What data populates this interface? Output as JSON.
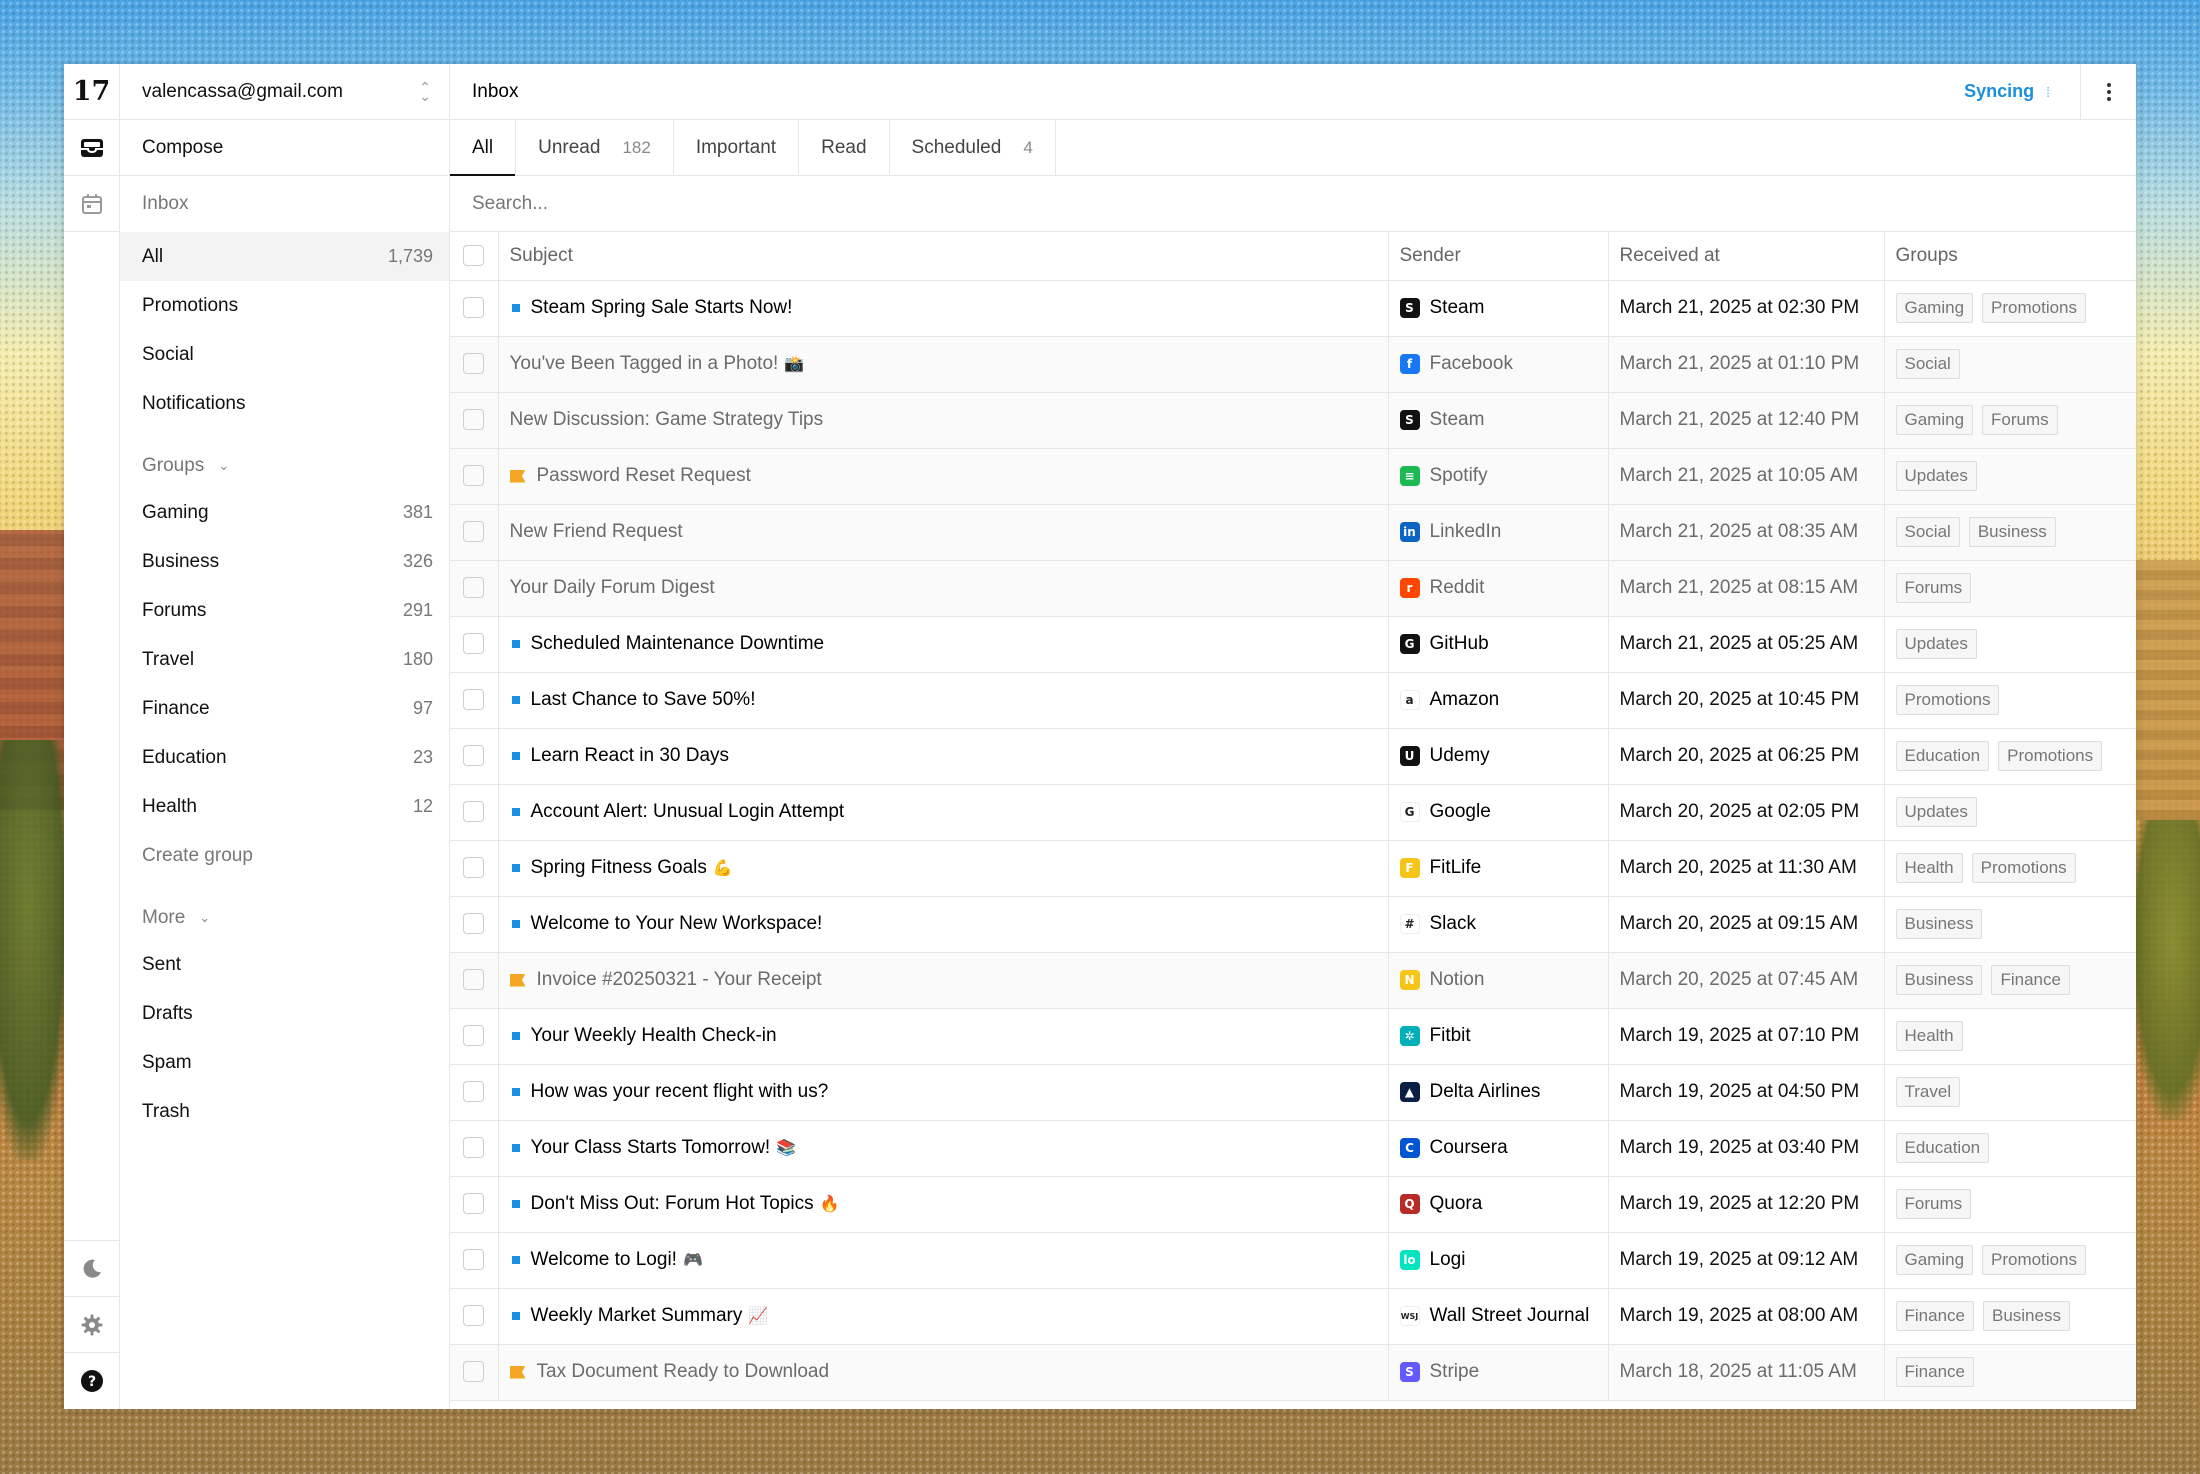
{
  "app": {
    "logo": "17",
    "account": "valencassa@gmail.com",
    "compose": "Compose",
    "inbox_label": "Inbox",
    "create_group": "Create group"
  },
  "sidebar": {
    "main_items": [
      {
        "label": "All",
        "count": "1,739"
      },
      {
        "label": "Promotions",
        "count": ""
      },
      {
        "label": "Social",
        "count": ""
      },
      {
        "label": "Notifications",
        "count": ""
      }
    ],
    "groups_label": "Groups",
    "groups": [
      {
        "label": "Gaming",
        "count": "381"
      },
      {
        "label": "Business",
        "count": "326"
      },
      {
        "label": "Forums",
        "count": "291"
      },
      {
        "label": "Travel",
        "count": "180"
      },
      {
        "label": "Finance",
        "count": "97"
      },
      {
        "label": "Education",
        "count": "23"
      },
      {
        "label": "Health",
        "count": "12"
      }
    ],
    "more_label": "More",
    "more": [
      {
        "label": "Sent"
      },
      {
        "label": "Drafts"
      },
      {
        "label": "Spam"
      },
      {
        "label": "Trash"
      }
    ]
  },
  "header": {
    "title": "Inbox",
    "status": "Syncing"
  },
  "tabs": [
    {
      "label": "All",
      "count": ""
    },
    {
      "label": "Unread",
      "count": "182"
    },
    {
      "label": "Important",
      "count": ""
    },
    {
      "label": "Read",
      "count": ""
    },
    {
      "label": "Scheduled",
      "count": "4"
    }
  ],
  "search": {
    "placeholder": "Search..."
  },
  "table": {
    "columns": [
      "Subject",
      "Sender",
      "Received at",
      "Groups"
    ],
    "rows": [
      {
        "subject": "Steam Spring Sale Starts Now!",
        "emoji": "",
        "marker": "dot",
        "read": false,
        "sender": "Steam",
        "icon": {
          "glyph": "S",
          "bg": "#111111"
        },
        "received": "March 21, 2025 at 02:30 PM",
        "groups": [
          "Gaming",
          "Promotions"
        ]
      },
      {
        "subject": "You've Been Tagged in a Photo!",
        "emoji": "📸",
        "marker": "none",
        "read": true,
        "sender": "Facebook",
        "icon": {
          "glyph": "f",
          "bg": "#1877f2"
        },
        "received": "March 21, 2025 at 01:10 PM",
        "groups": [
          "Social"
        ]
      },
      {
        "subject": "New Discussion: Game Strategy Tips",
        "emoji": "",
        "marker": "none",
        "read": true,
        "sender": "Steam",
        "icon": {
          "glyph": "S",
          "bg": "#111111"
        },
        "received": "March 21, 2025 at 12:40 PM",
        "groups": [
          "Gaming",
          "Forums"
        ]
      },
      {
        "subject": "Password Reset Request",
        "emoji": "",
        "marker": "flag",
        "read": true,
        "sender": "Spotify",
        "icon": {
          "glyph": "≡",
          "bg": "#1db954"
        },
        "received": "March 21, 2025 at 10:05 AM",
        "groups": [
          "Updates"
        ]
      },
      {
        "subject": "New Friend Request",
        "emoji": "",
        "marker": "none",
        "read": true,
        "sender": "LinkedIn",
        "icon": {
          "glyph": "in",
          "bg": "#0a66c2"
        },
        "received": "March 21, 2025 at 08:35 AM",
        "groups": [
          "Social",
          "Business"
        ]
      },
      {
        "subject": "Your Daily Forum Digest",
        "emoji": "",
        "marker": "none",
        "read": true,
        "sender": "Reddit",
        "icon": {
          "glyph": "r",
          "bg": "#ff4500"
        },
        "received": "March 21, 2025 at 08:15 AM",
        "groups": [
          "Forums"
        ]
      },
      {
        "subject": "Scheduled Maintenance Downtime",
        "emoji": "",
        "marker": "dot",
        "read": false,
        "sender": "GitHub",
        "icon": {
          "glyph": "G",
          "bg": "#111111"
        },
        "received": "March 21, 2025 at 05:25 AM",
        "groups": [
          "Updates"
        ]
      },
      {
        "subject": "Last Chance to Save 50%!",
        "emoji": "",
        "marker": "dot",
        "read": false,
        "sender": "Amazon",
        "icon": {
          "glyph": "a",
          "bg": "#ffffff"
        },
        "received": "March 20, 2025 at 10:45 PM",
        "groups": [
          "Promotions"
        ]
      },
      {
        "subject": "Learn React in 30 Days",
        "emoji": "",
        "marker": "dot",
        "read": false,
        "sender": "Udemy",
        "icon": {
          "glyph": "U",
          "bg": "#111111"
        },
        "received": "March 20, 2025 at 06:25 PM",
        "groups": [
          "Education",
          "Promotions"
        ]
      },
      {
        "subject": "Account Alert: Unusual Login Attempt",
        "emoji": "",
        "marker": "dot",
        "read": false,
        "sender": "Google",
        "icon": {
          "glyph": "G",
          "bg": "#ffffff"
        },
        "received": "March 20, 2025 at 02:05 PM",
        "groups": [
          "Updates"
        ]
      },
      {
        "subject": "Spring Fitness Goals",
        "emoji": "💪",
        "marker": "dot",
        "read": false,
        "sender": "FitLife",
        "icon": {
          "glyph": "F",
          "bg": "#f5c518"
        },
        "received": "March 20, 2025 at 11:30 AM",
        "groups": [
          "Health",
          "Promotions"
        ]
      },
      {
        "subject": "Welcome to Your New Workspace!",
        "emoji": "",
        "marker": "dot",
        "read": false,
        "sender": "Slack",
        "icon": {
          "glyph": "#",
          "bg": "#ffffff"
        },
        "received": "March 20, 2025 at 09:15 AM",
        "groups": [
          "Business"
        ]
      },
      {
        "subject": "Invoice #20250321 - Your Receipt",
        "emoji": "",
        "marker": "flag",
        "read": true,
        "sender": "Notion",
        "icon": {
          "glyph": "N",
          "bg": "#f5c518"
        },
        "received": "March 20, 2025 at 07:45 AM",
        "groups": [
          "Business",
          "Finance"
        ]
      },
      {
        "subject": "Your Weekly Health Check-in",
        "emoji": "",
        "marker": "dot",
        "read": false,
        "sender": "Fitbit",
        "icon": {
          "glyph": "✲",
          "bg": "#00b0b9"
        },
        "received": "March 19, 2025 at 07:10 PM",
        "groups": [
          "Health"
        ]
      },
      {
        "subject": "How was your recent flight with us?",
        "emoji": "",
        "marker": "dot",
        "read": false,
        "sender": "Delta Airlines",
        "icon": {
          "glyph": "▲",
          "bg": "#0b1f44"
        },
        "received": "March 19, 2025 at 04:50 PM",
        "groups": [
          "Travel"
        ]
      },
      {
        "subject": "Your Class Starts Tomorrow!",
        "emoji": "📚",
        "marker": "dot",
        "read": false,
        "sender": "Coursera",
        "icon": {
          "glyph": "C",
          "bg": "#0056d2"
        },
        "received": "March 19, 2025 at 03:40 PM",
        "groups": [
          "Education"
        ]
      },
      {
        "subject": "Don't Miss Out: Forum Hot Topics",
        "emoji": "🔥",
        "marker": "dot",
        "read": false,
        "sender": "Quora",
        "icon": {
          "glyph": "Q",
          "bg": "#b92b27"
        },
        "received": "March 19, 2025 at 12:20 PM",
        "groups": [
          "Forums"
        ]
      },
      {
        "subject": "Welcome to Logi!",
        "emoji": "🎮",
        "marker": "dot",
        "read": false,
        "sender": "Logi",
        "icon": {
          "glyph": "lo",
          "bg": "#00e5c0"
        },
        "received": "March 19, 2025 at 09:12 AM",
        "groups": [
          "Gaming",
          "Promotions"
        ]
      },
      {
        "subject": "Weekly Market Summary",
        "emoji": "📈",
        "marker": "dot",
        "read": false,
        "sender": "Wall Street Journal",
        "icon": {
          "glyph": "WSJ",
          "bg": "#ffffff"
        },
        "received": "March 19, 2025 at 08:00 AM",
        "groups": [
          "Finance",
          "Business"
        ]
      },
      {
        "subject": "Tax Document Ready to Download",
        "emoji": "",
        "marker": "flag",
        "read": true,
        "sender": "Stripe",
        "icon": {
          "glyph": "S",
          "bg": "#635bff"
        },
        "received": "March 18, 2025 at 11:05 AM",
        "groups": [
          "Finance"
        ]
      }
    ]
  },
  "colors": {
    "accent": "#1a8fe0",
    "unread_dot": "#1a8fe0",
    "important_flag": "#f5a623"
  },
  "icons": {
    "rail_top": [
      "inbox-tray-icon",
      "calendar-icon"
    ],
    "rail_bottom": [
      "moon-icon",
      "gear-icon",
      "help-icon"
    ],
    "header": [
      "spinner-icon",
      "kebab-menu-icon"
    ]
  }
}
